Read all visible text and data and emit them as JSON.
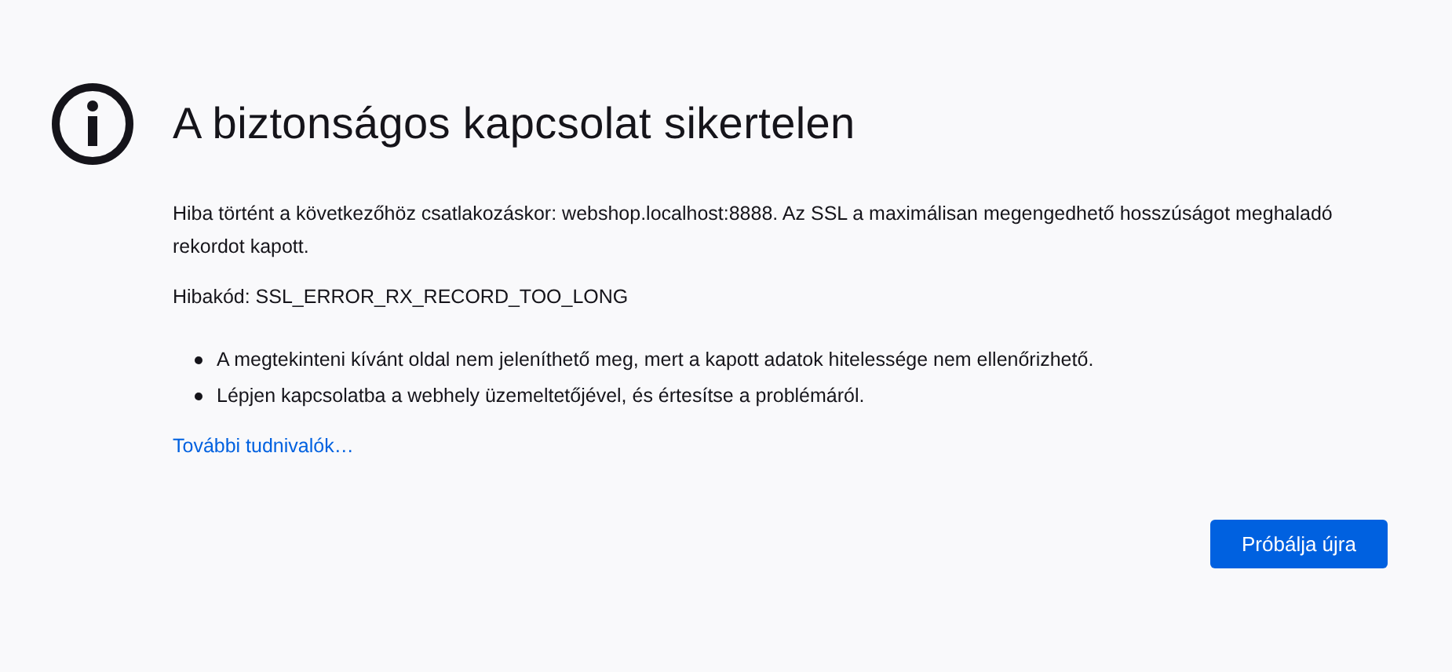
{
  "title": "A biztonságos kapcsolat sikertelen",
  "description": "Hiba történt a következőhöz csatlakozáskor: webshop.localhost:8888. Az SSL a maximálisan megengedhető hosszúságot meghaladó rekordot kapott.",
  "error_code": "Hibakód: SSL_ERROR_RX_RECORD_TOO_LONG",
  "bullets": [
    "A megtekinteni kívánt oldal nem jeleníthető meg, mert a kapott adatok hitelessége nem ellenőrizhető.",
    "Lépjen kapcsolatba a webhely üzemeltetőjével, és értesítse a problémáról."
  ],
  "learn_more_link": "További tudnivalók…",
  "retry_button": "Próbálja újra"
}
